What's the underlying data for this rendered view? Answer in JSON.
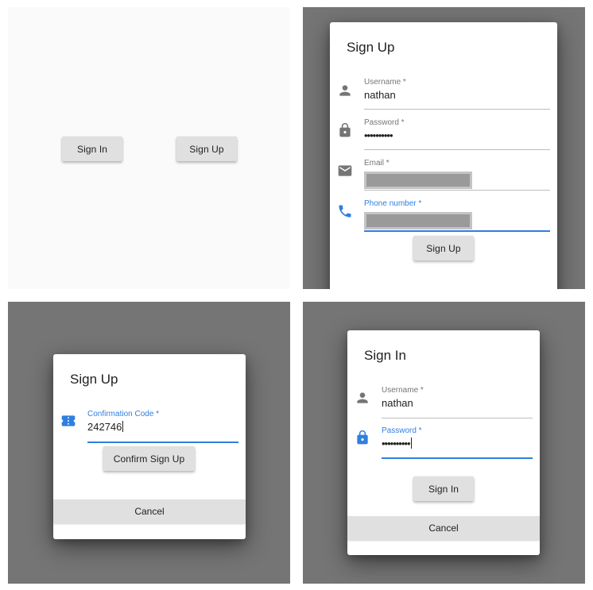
{
  "home": {
    "sign_in_button": "Sign In",
    "sign_up_button": "Sign Up"
  },
  "sign_up_form": {
    "title": "Sign Up",
    "username_label": "Username *",
    "username_value": "nathan",
    "password_label": "Password *",
    "password_value": "••••••••••",
    "email_label": "Email *",
    "phone_label": "Phone number *",
    "submit_button": "Sign Up"
  },
  "confirm_form": {
    "title": "Sign Up",
    "code_label": "Confirmation Code *",
    "code_value": "242746",
    "confirm_button": "Confirm Sign Up",
    "cancel_button": "Cancel"
  },
  "sign_in_form": {
    "title": "Sign In",
    "username_label": "Username *",
    "username_value": "nathan",
    "password_label": "Password *",
    "password_value": "••••••••••",
    "submit_button": "Sign In",
    "cancel_button": "Cancel"
  },
  "colors": {
    "accent": "#2f7fe0",
    "overlay": "#757575",
    "button_bg": "#e0e0e0",
    "icon_gray": "#757575"
  },
  "icons": [
    "person-icon",
    "lock-icon",
    "mail-icon",
    "phone-icon",
    "ticket-icon"
  ]
}
